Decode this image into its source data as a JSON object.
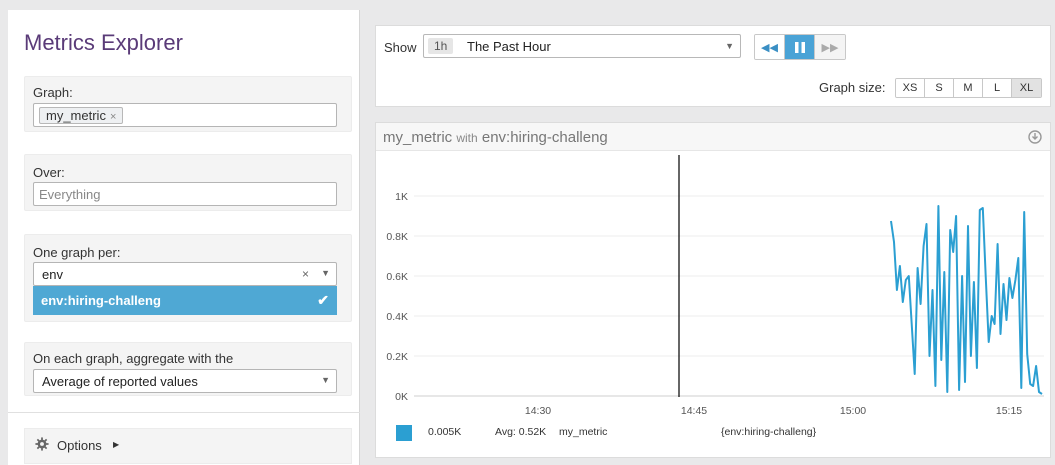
{
  "sidebar": {
    "title": "Metrics Explorer",
    "graph_label": "Graph:",
    "graph_metric": "my_metric",
    "graph_metric_remove": "×",
    "over_label": "Over:",
    "over_placeholder": "Everything",
    "one_graph_label": "One graph per:",
    "one_graph_value": "env",
    "one_graph_clear": "×",
    "one_graph_option": "env:hiring-challeng",
    "one_graph_option_check": "✔",
    "aggregate_label": "On each graph, aggregate with the",
    "aggregate_value": "Average of reported values",
    "options_label": "Options"
  },
  "toolbar": {
    "show_label": "Show",
    "time_badge": "1h",
    "time_value": "The Past Hour",
    "graph_size_label": "Graph size:",
    "sizes": [
      "XS",
      "S",
      "M",
      "L",
      "XL"
    ],
    "active_size": "XL"
  },
  "graph": {
    "metric": "my_metric",
    "with_text": "with",
    "scope": "env:hiring-challeng"
  },
  "legend": {
    "color": "#2b9fd2",
    "value": "0.005K",
    "avg": "Avg: 0.52K",
    "metric": "my_metric",
    "scope": "{env:hiring-challeng}"
  },
  "chart_data": {
    "type": "line",
    "yticks": [
      "0K",
      "0.2K",
      "0.4K",
      "0.6K",
      "0.8K",
      "1K"
    ],
    "ylim": [
      0,
      1000
    ],
    "xticks": [
      "14:30",
      "14:45",
      "15:00",
      "15:15"
    ],
    "series": [
      {
        "name": "my_metric",
        "color": "#2b9fd2",
        "values": [
          875,
          770,
          530,
          650,
          470,
          580,
          600,
          360,
          110,
          640,
          460,
          750,
          860,
          200,
          530,
          50,
          950,
          180,
          620,
          20,
          830,
          720,
          900,
          30,
          600,
          70,
          850,
          200,
          570,
          140,
          930,
          940,
          600,
          270,
          400,
          360,
          760,
          310,
          560,
          380,
          590,
          490,
          580,
          690,
          40,
          920,
          210,
          60,
          50,
          150,
          20,
          10
        ]
      }
    ]
  }
}
